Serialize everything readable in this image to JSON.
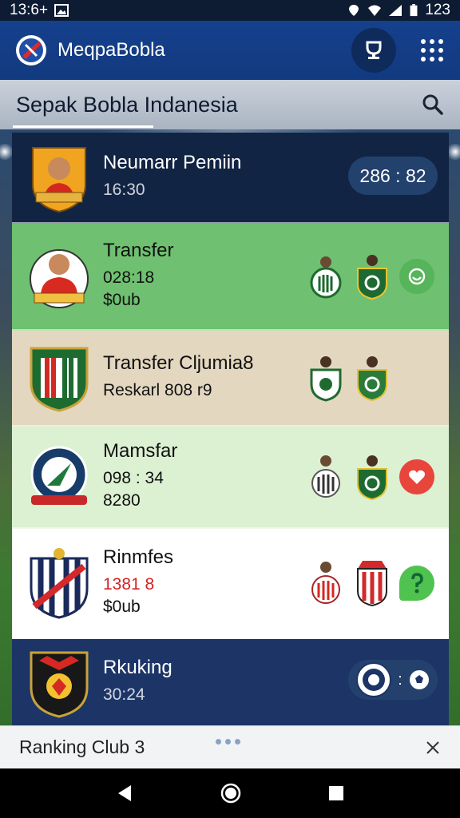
{
  "status_bar": {
    "time": "13:6+",
    "battery": "123"
  },
  "app_bar": {
    "title": "MeqpaBobla"
  },
  "search": {
    "title": "Sepak Bobla  Indanesia"
  },
  "cards": [
    {
      "name": "Neumarr Pemiin",
      "line1": "16:30",
      "score": "286 : 82"
    },
    {
      "name": "Transfer",
      "line1": "028:18",
      "line2": "$0ub"
    },
    {
      "name": "Transfer Cljumia8",
      "line1": "Reskarl  808 r9"
    },
    {
      "name": "Mamsfar",
      "line1": "098 : 34",
      "line2": "8280"
    },
    {
      "name": "Rinmfes",
      "line1": "1381 8",
      "line2": "$0ub"
    },
    {
      "name": "Rkuking",
      "line1": "30:24"
    }
  ],
  "bottom_sheet": {
    "title": "Ranking Club 3"
  },
  "colors": {
    "app_blue": "#15408c",
    "card_green": "#6fc070",
    "card_dark": "#122443",
    "card_beige": "#e3d7c0"
  }
}
